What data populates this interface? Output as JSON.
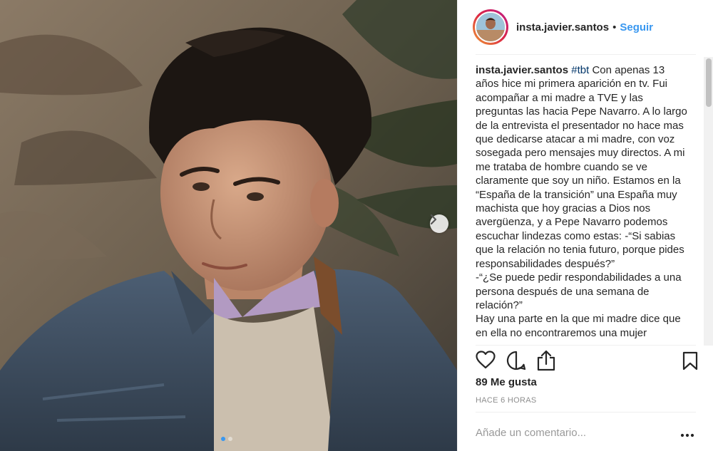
{
  "header": {
    "username": "insta.javier.santos",
    "bullet": "•",
    "follow_label": "Seguir"
  },
  "caption": {
    "username": "insta.javier.santos",
    "hashtag": "#tbt",
    "text": " Con apenas 13 años hice mi primera aparición en tv. Fui acompañar a mi madre a TVE y las preguntas las hacia Pepe Navarro. A lo largo de la entrevista el presentador no hace mas que dedicarse atacar a mi madre, con voz sosegada pero mensajes muy directos. A mi me trataba de hombre cuando se ve claramente que soy un niño. Estamos en la “España de la transición” una España muy machista que hoy gracias a Dios nos avergüenza, y a Pepe Navarro podemos escuchar lindezas como estas: -“Si sabias que la relación no tenia futuro, porque pides responsabilidades después?”\n-“¿Se puede pedir respondabilidades a una persona después de una semana de relación?”\nHay una parte en la que mi madre dice que en ella no encontraremos una mujer"
  },
  "stats": {
    "likes": "89 Me gusta",
    "time": "HACE 6 HORAS"
  },
  "comment": {
    "placeholder": "Añade un comentario..."
  },
  "carousel": {
    "slide_count": 2,
    "active_index": 0
  },
  "icons": {
    "next": "chevron-right-icon",
    "like": "heart-icon",
    "comment": "comment-bubble-icon",
    "share": "share-icon",
    "save": "bookmark-icon",
    "more": "more-options-icon"
  },
  "colors": {
    "link_blue": "#3897f0",
    "text": "#262626",
    "muted": "#8e8e8e",
    "hashtag": "#003569"
  }
}
